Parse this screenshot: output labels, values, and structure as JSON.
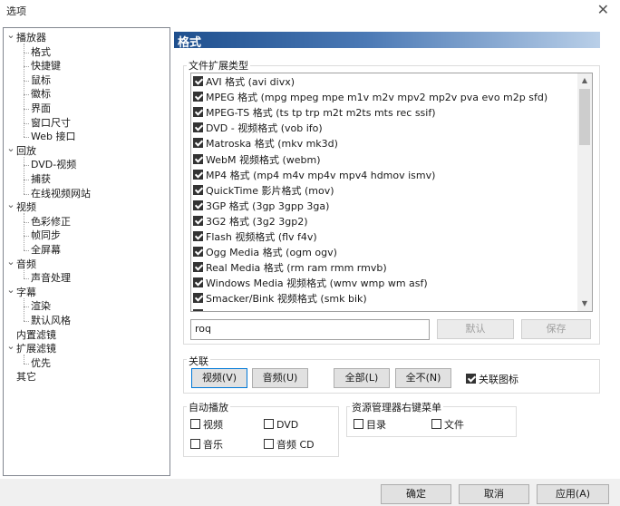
{
  "window": {
    "title": "选项",
    "close_glyph": "✕"
  },
  "tree": [
    {
      "label": "播放器",
      "level": 0,
      "expanded": true
    },
    {
      "label": "格式",
      "level": 1
    },
    {
      "label": "快捷键",
      "level": 1
    },
    {
      "label": "鼠标",
      "level": 1
    },
    {
      "label": "徽标",
      "level": 1
    },
    {
      "label": "界面",
      "level": 1
    },
    {
      "label": "窗口尺寸",
      "level": 1
    },
    {
      "label": "Web 接口",
      "level": 1
    },
    {
      "label": "回放",
      "level": 0,
      "expanded": true
    },
    {
      "label": "DVD-视频",
      "level": 1
    },
    {
      "label": "捕获",
      "level": 1
    },
    {
      "label": "在线视频网站",
      "level": 1
    },
    {
      "label": "视频",
      "level": 0,
      "expanded": true
    },
    {
      "label": "色彩修正",
      "level": 1
    },
    {
      "label": "帧同步",
      "level": 1
    },
    {
      "label": "全屏幕",
      "level": 1
    },
    {
      "label": "音频",
      "level": 0,
      "expanded": true
    },
    {
      "label": "声音处理",
      "level": 1
    },
    {
      "label": "字幕",
      "level": 0,
      "expanded": true
    },
    {
      "label": "渲染",
      "level": 1
    },
    {
      "label": "默认风格",
      "level": 1
    },
    {
      "label": "内置滤镜",
      "level": 0,
      "expanded": false
    },
    {
      "label": "扩展滤镜",
      "level": 0,
      "expanded": true
    },
    {
      "label": "优先",
      "level": 1
    },
    {
      "label": "其它",
      "level": 0,
      "expanded": false
    }
  ],
  "panel": {
    "title": "格式",
    "file_ext_group": "文件扩展类型",
    "formats": [
      {
        "label": "AVI 格式 (avi divx)",
        "checked": true
      },
      {
        "label": "MPEG 格式 (mpg mpeg mpe m1v m2v mpv2 mp2v pva evo m2p sfd)",
        "checked": true
      },
      {
        "label": "MPEG-TS 格式 (ts tp trp m2t m2ts mts rec ssif)",
        "checked": true
      },
      {
        "label": "DVD - 视频格式 (vob ifo)",
        "checked": true
      },
      {
        "label": "Matroska 格式 (mkv mk3d)",
        "checked": true
      },
      {
        "label": "WebM 视频格式 (webm)",
        "checked": true
      },
      {
        "label": "MP4 格式 (mp4 m4v mp4v mpv4 hdmov ismv)",
        "checked": true
      },
      {
        "label": "QuickTime 影片格式 (mov)",
        "checked": true
      },
      {
        "label": "3GP 格式 (3gp 3gpp 3ga)",
        "checked": true
      },
      {
        "label": "3G2 格式 (3g2 3gp2)",
        "checked": true
      },
      {
        "label": "Flash 视频格式 (flv f4v)",
        "checked": true
      },
      {
        "label": "Ogg Media 格式 (ogm ogv)",
        "checked": true
      },
      {
        "label": "Real Media 格式 (rm ram rmm rmvb)",
        "checked": true
      },
      {
        "label": "Windows Media 视频格式 (wmv wmp wm asf)",
        "checked": true
      },
      {
        "label": "Smacker/Bink 视频格式 (smk bik)",
        "checked": true
      }
    ],
    "ext_value": "roq",
    "default_btn": "默认",
    "save_btn": "保存",
    "assoc_group": "关联",
    "video_btn": "视频(V)",
    "audio_btn": "音频(U)",
    "all_btn": "全部(L)",
    "none_btn": "全不(N)",
    "assoc_icon_label": "关联图标",
    "autoplay_group": "自动播放",
    "autoplay": {
      "video": "视频",
      "dvd": "DVD",
      "music": "音乐",
      "audio_cd": "音频 CD"
    },
    "explorer_group": "资源管理器右键菜单",
    "explorer": {
      "dir": "目录",
      "file": "文件"
    }
  },
  "footer": {
    "ok": "确定",
    "cancel": "取消",
    "apply": "应用(A)"
  }
}
